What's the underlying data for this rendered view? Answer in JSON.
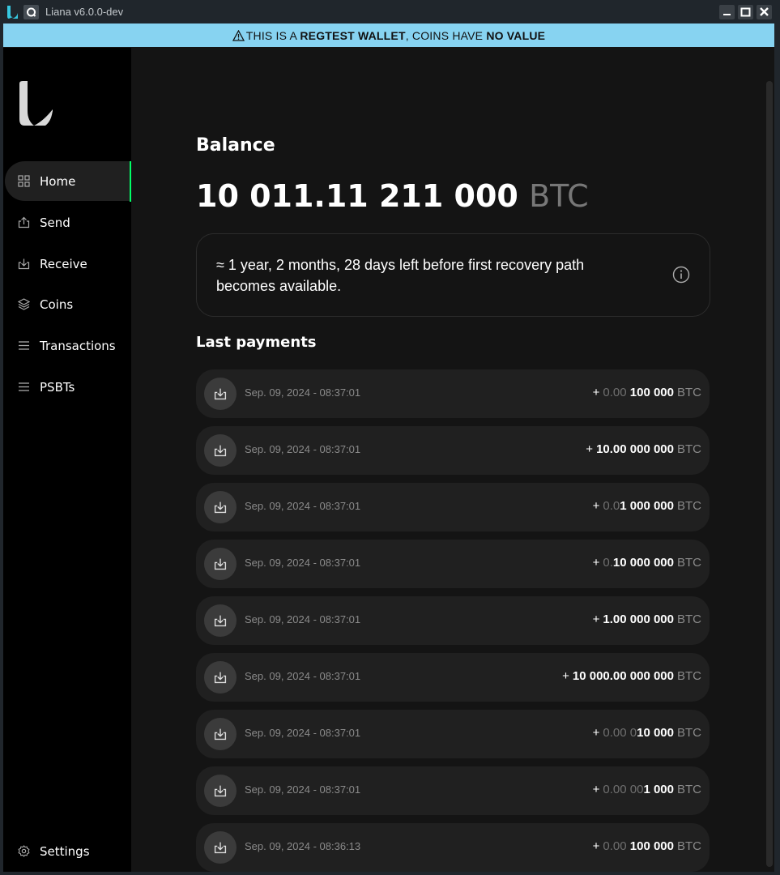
{
  "window": {
    "title": "Liana v6.0.0-dev"
  },
  "banner": {
    "prefix": "THIS IS A ",
    "strong1": "REGTEST WALLET",
    "middle": ", COINS HAVE ",
    "strong2": "NO VALUE",
    "warning_icon": "warning-icon"
  },
  "sidebar": {
    "items": [
      {
        "label": "Home",
        "icon": "grid-icon",
        "active": true
      },
      {
        "label": "Send",
        "icon": "send-icon"
      },
      {
        "label": "Receive",
        "icon": "receive-icon"
      },
      {
        "label": "Coins",
        "icon": "layers-icon"
      },
      {
        "label": "Transactions",
        "icon": "list-icon"
      },
      {
        "label": "PSBTs",
        "icon": "list-icon"
      }
    ],
    "settings": {
      "label": "Settings",
      "icon": "gear-icon"
    },
    "accent_color": "#00ff66"
  },
  "home": {
    "balance_heading": "Balance",
    "balance_value": "10 011.11 211 000",
    "balance_unit": "BTC",
    "notice": "≈ 1 year, 2 months, 28 days left before first recovery path becomes available.",
    "last_payments_heading": "Last payments",
    "payments": [
      {
        "date": "Sep. 09, 2024 - 08:37:01",
        "sign": "+",
        "dim": "0.00 ",
        "bright": "100 000",
        "unit": "BTC"
      },
      {
        "date": "Sep. 09, 2024 - 08:37:01",
        "sign": "+",
        "dim": "",
        "bright": "10.00 000 000",
        "unit": "BTC"
      },
      {
        "date": "Sep. 09, 2024 - 08:37:01",
        "sign": "+",
        "dim": "0.0",
        "bright": "1 000 000",
        "unit": "BTC"
      },
      {
        "date": "Sep. 09, 2024 - 08:37:01",
        "sign": "+",
        "dim": "0.",
        "bright": "10 000 000",
        "unit": "BTC"
      },
      {
        "date": "Sep. 09, 2024 - 08:37:01",
        "sign": "+",
        "dim": "",
        "bright": "1.00 000 000",
        "unit": "BTC"
      },
      {
        "date": "Sep. 09, 2024 - 08:37:01",
        "sign": "+",
        "dim": "",
        "bright": "10 000.00 000 000",
        "unit": "BTC"
      },
      {
        "date": "Sep. 09, 2024 - 08:37:01",
        "sign": "+",
        "dim": "0.00 0",
        "bright": "10 000",
        "unit": "BTC"
      },
      {
        "date": "Sep. 09, 2024 - 08:37:01",
        "sign": "+",
        "dim": "0.00 00",
        "bright": "1 000",
        "unit": "BTC"
      },
      {
        "date": "Sep. 09, 2024 - 08:36:13",
        "sign": "+",
        "dim": "0.00 ",
        "bright": "100 000",
        "unit": "BTC"
      }
    ]
  }
}
